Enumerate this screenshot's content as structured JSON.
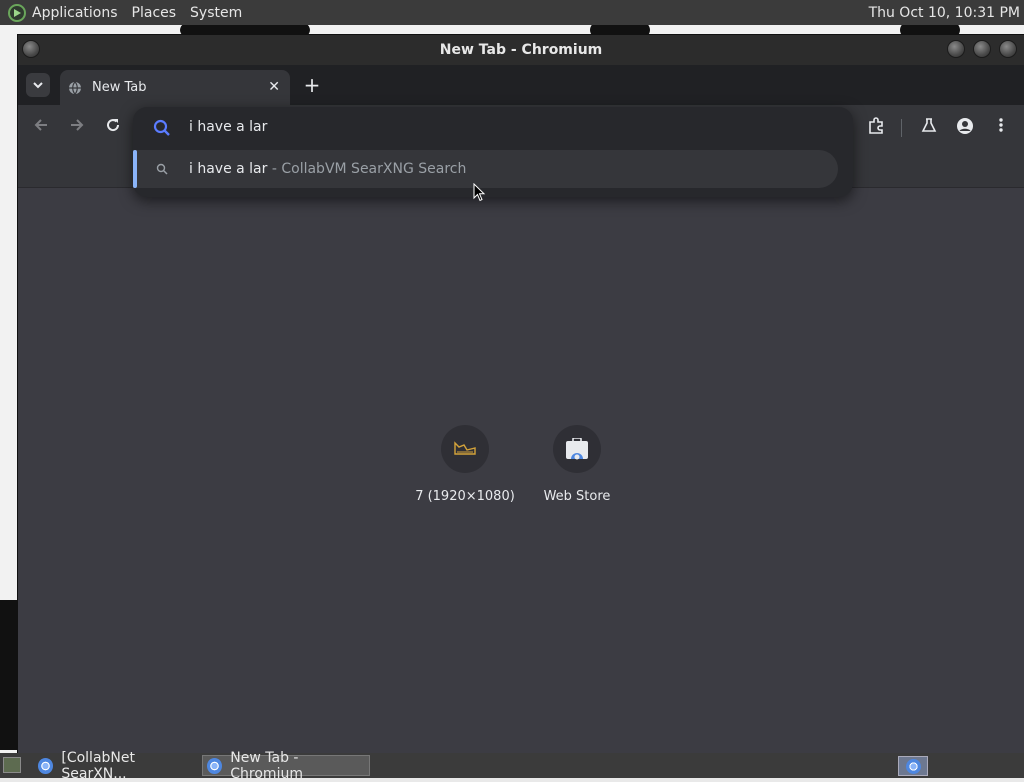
{
  "top_panel": {
    "menus": [
      "Applications",
      "Places",
      "System"
    ],
    "clock": "Thu Oct 10, 10:31 PM"
  },
  "window": {
    "title": "New Tab - Chromium"
  },
  "tabs": [
    {
      "title": "New Tab",
      "icon": "globe-icon"
    }
  ],
  "omnibox": {
    "query": "i have a lar",
    "suggestion": {
      "text": "i have a lar",
      "separator": " - ",
      "engine": "CollabVM SearXNG Search"
    }
  },
  "shortcuts": [
    {
      "label": "7 (1920×1080)",
      "icon": "crown-icon"
    },
    {
      "label": "Web Store",
      "icon": "web-store-icon"
    }
  ],
  "taskbar": {
    "items": [
      {
        "label": "[CollabNet SearXN...",
        "active": false
      },
      {
        "label": "New Tab - Chromium",
        "active": true
      }
    ]
  },
  "colors": {
    "accent": "#8ab4f8",
    "omnibox_bg": "#27282c",
    "ntp_bg": "#3c3c43"
  }
}
